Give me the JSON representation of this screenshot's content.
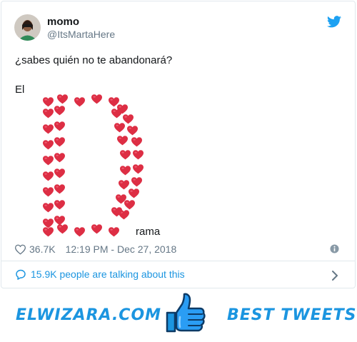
{
  "tweet": {
    "user": {
      "name": "momo",
      "handle": "@ItsMartaHere"
    },
    "text_line1": "¿sabes quién no te abandonará?",
    "text_line2": "El",
    "text_line3": "rama",
    "likes": "36.7K",
    "timestamp": "12:19 PM - Dec 27, 2018",
    "talking": "15.9K people are talking about this"
  },
  "footer": {
    "left_label": "ELWIZARA.COM",
    "right_label": "BEST TWEETS"
  },
  "icons": {
    "bird": "twitter-bird-icon",
    "like": "heart-outline-icon",
    "info": "info-icon",
    "comment": "comment-bubble-icon",
    "chevron": "chevron-right-icon",
    "thumb": "thumbs-up-icon",
    "heart_art": "red-heart-emoji"
  },
  "colors": {
    "accent": "#1b95e0",
    "heart": "#e0245e",
    "muted": "#657786"
  }
}
